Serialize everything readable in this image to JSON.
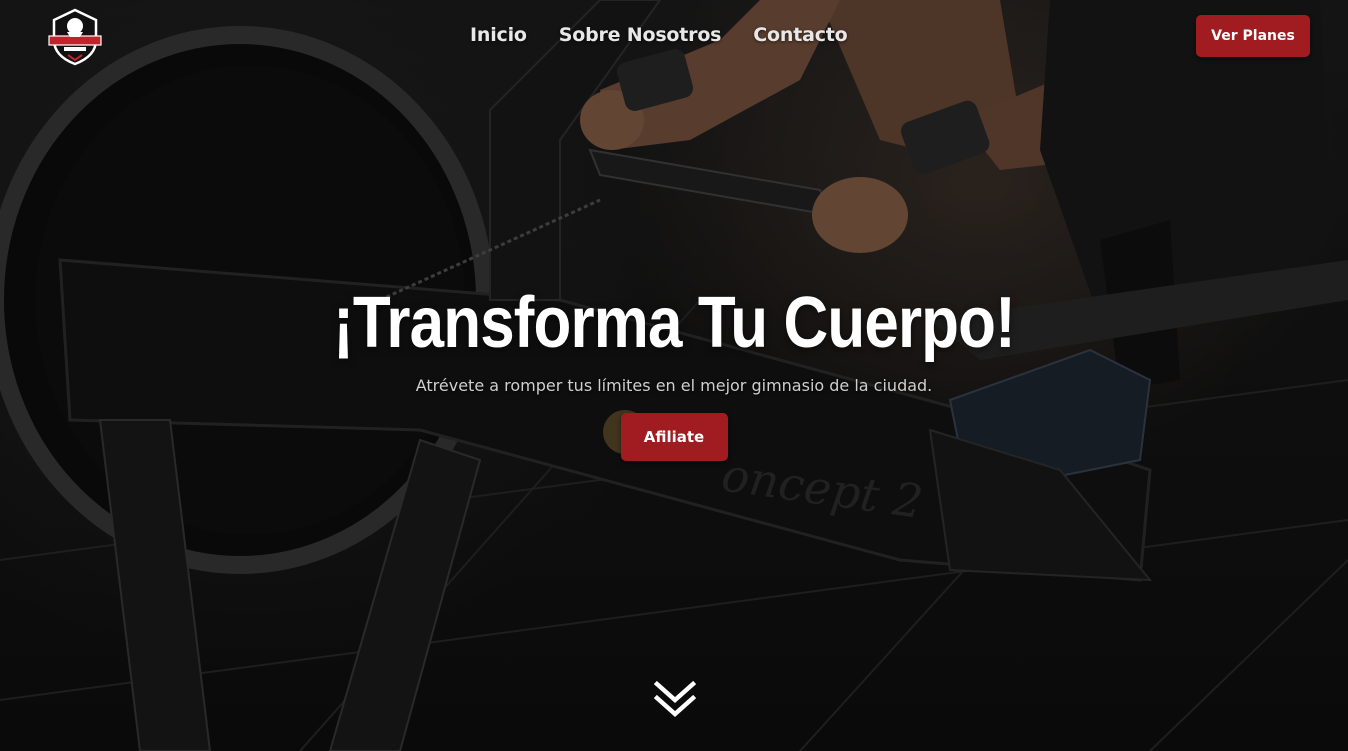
{
  "header": {
    "logo_icon": "gym-logo-icon",
    "nav": [
      {
        "label": "Inicio"
      },
      {
        "label": "Sobre Nosotros"
      },
      {
        "label": "Contacto"
      }
    ],
    "cta_label": "Ver Planes"
  },
  "hero": {
    "title": "¡Transforma Tu Cuerpo!",
    "subtitle": "Atrévete a romper tus límites en el mejor gimnasio de la ciudad.",
    "cta_label": "Afiliate",
    "scroll_icon": "double-chevron-down-icon"
  },
  "colors": {
    "accent": "#a01c20",
    "text": "#ffffff",
    "muted": "#cfcfcf"
  }
}
